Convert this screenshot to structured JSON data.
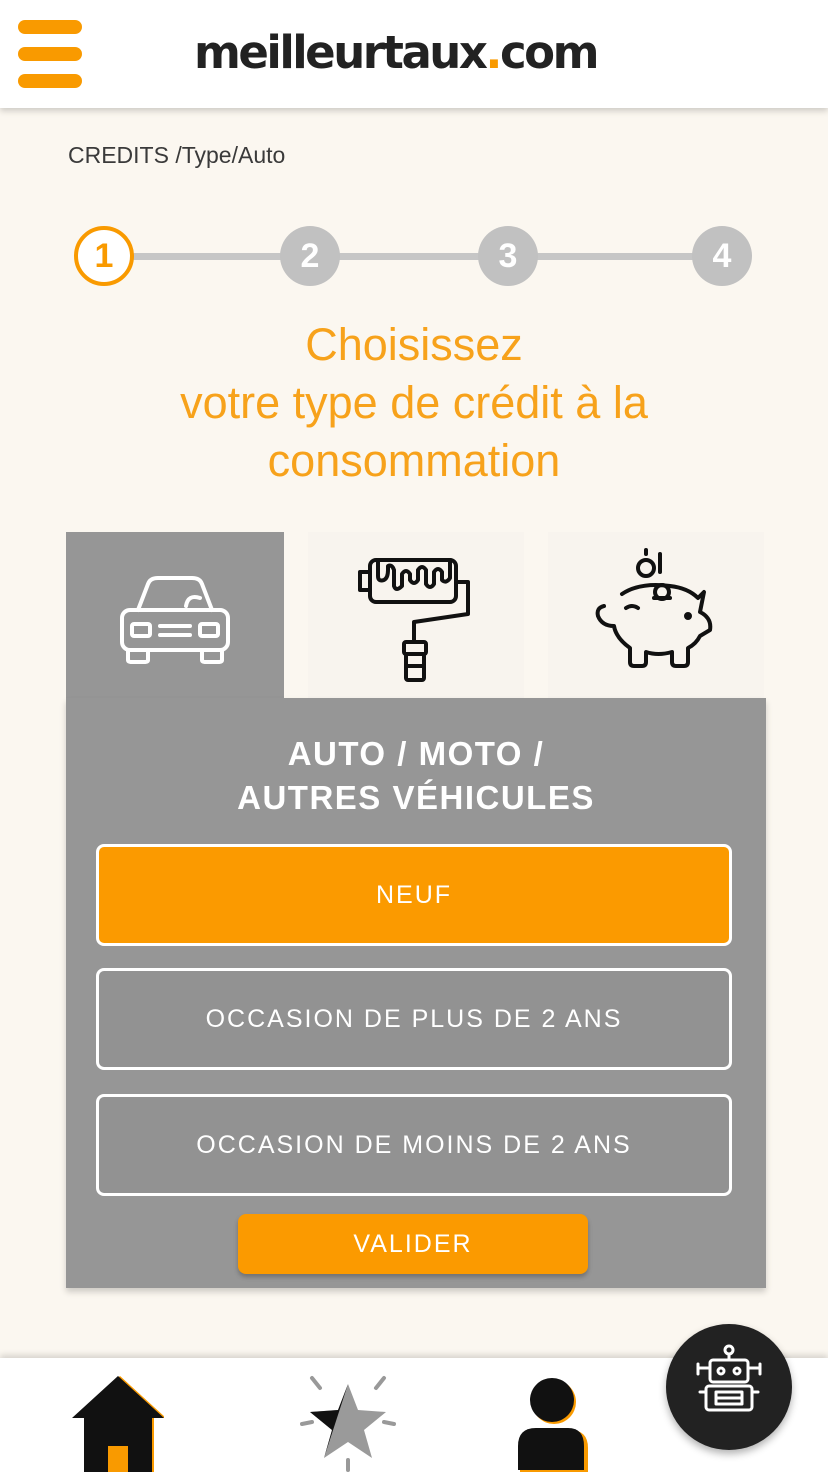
{
  "header": {
    "logo_main": "meilleurtaux",
    "logo_dot": ".",
    "logo_tld": "com",
    "menu_icon": "hamburger-menu-icon"
  },
  "breadcrumb": "CREDITS /Type/Auto",
  "stepper": {
    "steps": [
      "1",
      "2",
      "3",
      "4"
    ],
    "active_step": 1
  },
  "headline": {
    "line1": "Choisissez",
    "line2": "votre type de crédit à la",
    "line3": "consommation"
  },
  "categories": [
    {
      "icon": "car-icon",
      "selected": true
    },
    {
      "icon": "paint-roller-icon",
      "selected": false
    },
    {
      "icon": "piggy-bank-icon",
      "selected": false
    }
  ],
  "panel": {
    "title_line1": "AUTO / MOTO /",
    "title_line2": "AUTRES VÉHICULES",
    "options": [
      "NEUF",
      "OCCASION DE PLUS DE 2 ANS",
      "OCCASION DE MOINS DE 2 ANS"
    ],
    "selected_option": "NEUF",
    "submit_label": "VALIDER"
  },
  "bottom_nav": {
    "items": [
      "home-icon",
      "star-icon",
      "user-icon"
    ]
  },
  "chat": {
    "icon": "robot-icon"
  },
  "colors": {
    "accent": "#f99a00",
    "panel_gray": "#969696",
    "background": "#fbf7f0"
  }
}
